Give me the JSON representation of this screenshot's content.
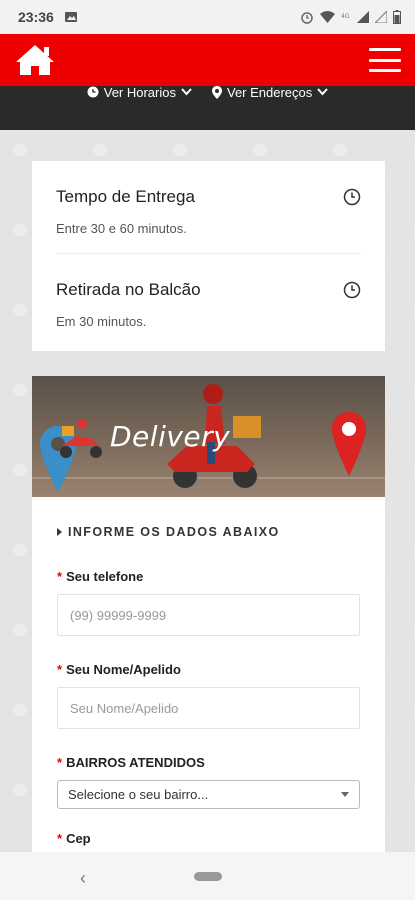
{
  "status_bar": {
    "time": "23:36",
    "icons": [
      "image-icon",
      "alarm-icon",
      "wifi-icon",
      "4g-icon",
      "signal-icon",
      "signal-empty-icon",
      "battery-icon"
    ]
  },
  "app_bar": {
    "home_icon": "home-icon",
    "menu_icon": "hamburger-menu-icon",
    "brand_color": "#ee0000"
  },
  "top_links": [
    {
      "label": "Ver Horarios",
      "icon": "clock-icon"
    },
    {
      "label": "Ver Endereços",
      "icon": "location-pin-icon"
    }
  ],
  "info_card": {
    "items": [
      {
        "title": "Tempo de Entrega",
        "subtitle": "Entre 30 e 60 minutos.",
        "icon": "clock-icon"
      },
      {
        "title": "Retirada no Balcão",
        "subtitle": "Em 30 minutos.",
        "icon": "clock-icon"
      }
    ]
  },
  "banner": {
    "text": "Delivery"
  },
  "form": {
    "section_title": "INFORME OS DADOS ABAIXO",
    "required_mark": "*",
    "phone": {
      "label": "Seu telefone",
      "placeholder": "(99) 99999-9999"
    },
    "name": {
      "label": "Seu Nome/Apelido",
      "placeholder": "Seu Nome/Apelido"
    },
    "neighborhood": {
      "label": "BAIRROS ATENDIDOS",
      "selected": "Selecione o seu bairro..."
    },
    "cep": {
      "label": "Cep",
      "placeholder": ""
    }
  },
  "nav_bar": {
    "back_icon": "back-chevron-icon",
    "home_icon": "home-pill-icon"
  }
}
